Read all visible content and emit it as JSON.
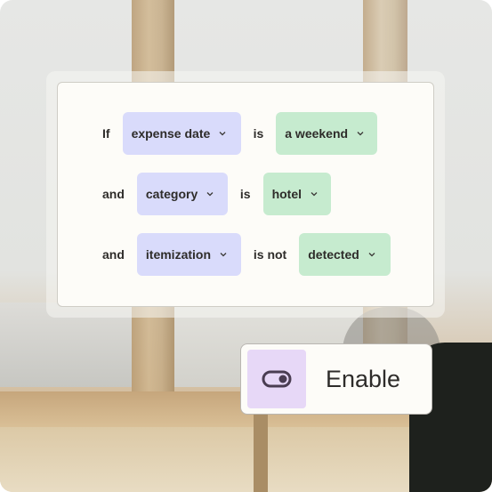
{
  "rule_builder": {
    "rows": [
      {
        "connector": "If",
        "field": "expense date",
        "operator": "is",
        "value": "a weekend"
      },
      {
        "connector": "and",
        "field": "category",
        "operator": "is",
        "value": "hotel"
      },
      {
        "connector": "and",
        "field": "itemization",
        "operator": "is not",
        "value": "detected"
      }
    ]
  },
  "enable_button": {
    "label": "Enable",
    "icon": "toggle-icon"
  },
  "colors": {
    "field_chip": "#d9dbfb",
    "value_chip": "#c6ebcf",
    "toggle_bg": "#e7d8f7",
    "text": "#2e2c2a"
  }
}
